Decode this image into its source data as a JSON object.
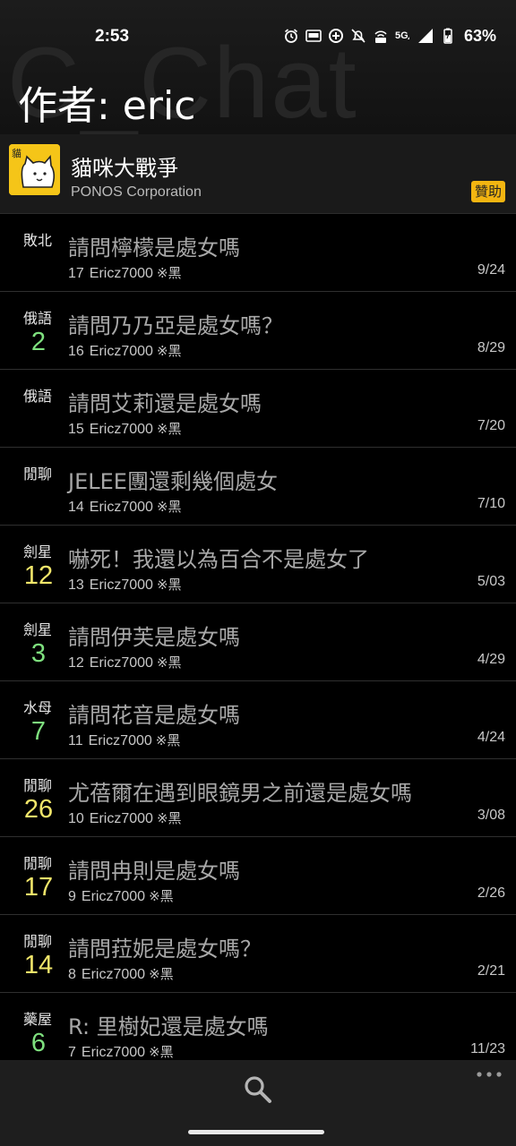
{
  "status_bar": {
    "time": "2:53",
    "battery": "63%",
    "icons": [
      "alarm-icon",
      "auto-brightness-icon",
      "data-saver-icon",
      "mute-icon",
      "volte-icon",
      "5g-icon",
      "signal-icon",
      "battery-icon"
    ]
  },
  "header": {
    "watermark": "C_Chat",
    "title": "作者: eric"
  },
  "app": {
    "name": "貓咪大戰爭",
    "developer": "PONOS Corporation",
    "sponsor_label": "贊助"
  },
  "posts": [
    {
      "tag": "敗北",
      "count": "",
      "count_color": "",
      "title": "請問檸檬是處女嗎",
      "floor": "17",
      "author": "Ericz7000",
      "mark": "※黑",
      "date": "9/24"
    },
    {
      "tag": "俄語",
      "count": "2",
      "count_color": "green",
      "title": "請問乃乃亞是處女嗎？",
      "floor": "16",
      "author": "Ericz7000",
      "mark": "※黑",
      "date": "8/29"
    },
    {
      "tag": "俄語",
      "count": "",
      "count_color": "",
      "title": "請問艾莉還是處女嗎",
      "floor": "15",
      "author": "Ericz7000",
      "mark": "※黑",
      "date": "7/20"
    },
    {
      "tag": "閒聊",
      "count": "",
      "count_color": "",
      "title": "JELEE團還剩幾個處女",
      "floor": "14",
      "author": "Ericz7000",
      "mark": "※黑",
      "date": "7/10"
    },
    {
      "tag": "劍星",
      "count": "12",
      "count_color": "yellow",
      "title": "嚇死！我還以為百合不是處女了",
      "floor": "13",
      "author": "Ericz7000",
      "mark": "※黑",
      "date": "5/03"
    },
    {
      "tag": "劍星",
      "count": "3",
      "count_color": "green",
      "title": "請問伊芙是處女嗎",
      "floor": "12",
      "author": "Ericz7000",
      "mark": "※黑",
      "date": "4/29"
    },
    {
      "tag": "水母",
      "count": "7",
      "count_color": "green",
      "title": "請問花音是處女嗎",
      "floor": "11",
      "author": "Ericz7000",
      "mark": "※黑",
      "date": "4/24"
    },
    {
      "tag": "閒聊",
      "count": "26",
      "count_color": "yellow",
      "title": "尤蓓爾在遇到眼鏡男之前還是處女嗎",
      "floor": "10",
      "author": "Ericz7000",
      "mark": "※黑",
      "date": "3/08"
    },
    {
      "tag": "閒聊",
      "count": "17",
      "count_color": "yellow",
      "title": "請問冉則是處女嗎",
      "floor": "9",
      "author": "Ericz7000",
      "mark": "※黑",
      "date": "2/26"
    },
    {
      "tag": "閒聊",
      "count": "14",
      "count_color": "yellow",
      "title": "請問菈妮是處女嗎？",
      "floor": "8",
      "author": "Ericz7000",
      "mark": "※黑",
      "date": "2/21"
    },
    {
      "tag": "藥屋",
      "count": "6",
      "count_color": "green",
      "title": "R: 里樹妃還是處女嗎",
      "floor": "7",
      "author": "Ericz7000",
      "mark": "※黑",
      "date": "11/23"
    }
  ],
  "bottom_bar": {
    "icons": [
      "search-icon",
      "more-icon"
    ]
  }
}
